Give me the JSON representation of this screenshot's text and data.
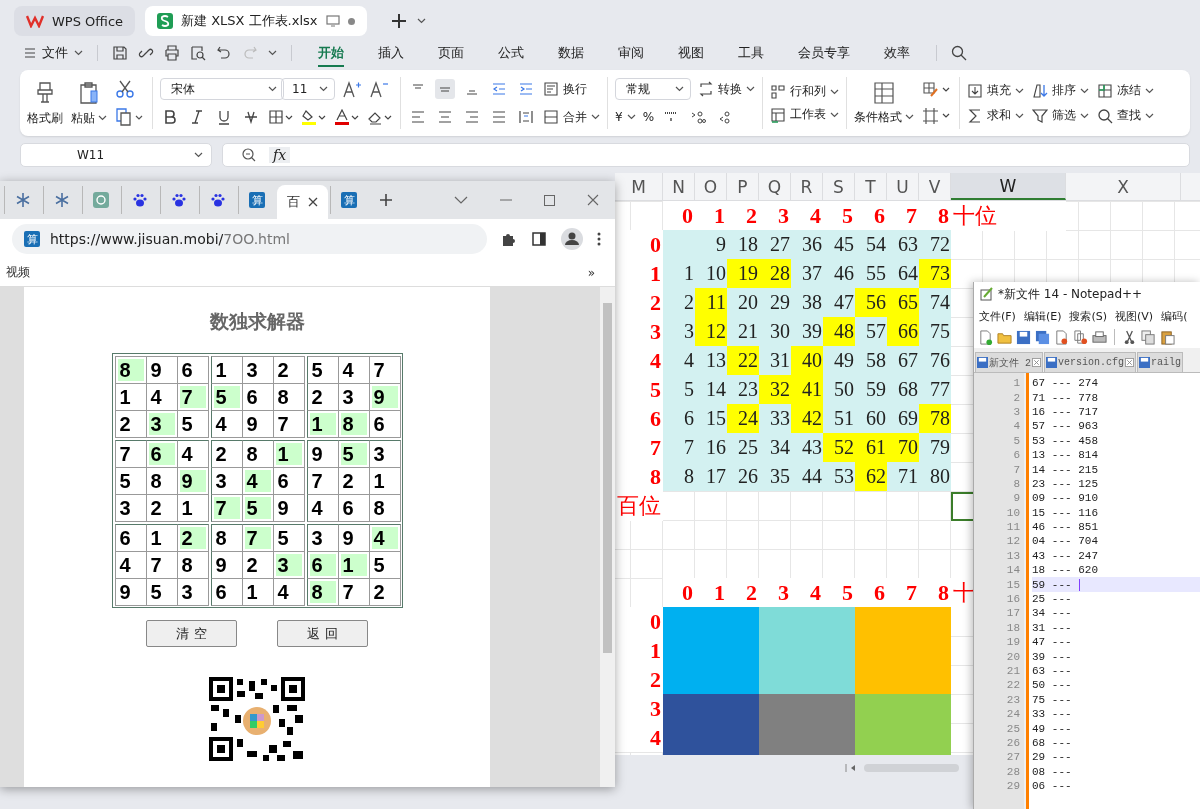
{
  "wps": {
    "tabs": [
      {
        "label": "WPS Office",
        "selected": false
      },
      {
        "label": "新建 XLSX 工作表.xlsx",
        "selected": true
      }
    ],
    "file_menu": "文件",
    "ribbon_tabs": [
      {
        "label": "开始",
        "selected": true
      },
      {
        "label": "插入",
        "selected": false
      },
      {
        "label": "页面",
        "selected": false
      },
      {
        "label": "公式",
        "selected": false
      },
      {
        "label": "数据",
        "selected": false
      },
      {
        "label": "审阅",
        "selected": false
      },
      {
        "label": "视图",
        "selected": false
      },
      {
        "label": "工具",
        "selected": false
      },
      {
        "label": "会员专享",
        "selected": false
      },
      {
        "label": "效率",
        "selected": false
      }
    ],
    "ribbon": {
      "format_painter": "格式刷",
      "paste": "粘贴",
      "font": "宋体",
      "font_size": "11",
      "wrap": "换行",
      "merge": "合并",
      "number_format": "常规",
      "convert": "转换",
      "currency": "¥",
      "percent": "%",
      "rows_cols": "行和列",
      "worksheet": "工作表",
      "conditional_format": "条件格式",
      "fill": "填充",
      "sum": "求和",
      "sort": "排序",
      "filter": "筛选",
      "freeze": "冻结",
      "find": "查找"
    },
    "name_box": "W11",
    "formula_label": "fx"
  },
  "sheet": {
    "columns": [
      {
        "label": "M",
        "selected": false
      },
      {
        "label": "N",
        "selected": false
      },
      {
        "label": "O",
        "selected": false
      },
      {
        "label": "P",
        "selected": false
      },
      {
        "label": "Q",
        "selected": false
      },
      {
        "label": "R",
        "selected": false
      },
      {
        "label": "S",
        "selected": false
      },
      {
        "label": "T",
        "selected": false
      },
      {
        "label": "U",
        "selected": false
      },
      {
        "label": "V",
        "selected": false
      },
      {
        "label": "W",
        "selected": true
      },
      {
        "label": "X",
        "selected": false
      }
    ],
    "grid": {
      "column_digits": [
        "0",
        "1",
        "2",
        "3",
        "4",
        "5",
        "6",
        "7",
        "8"
      ],
      "corner_label": "十位",
      "rows": [
        {
          "label": "0",
          "cells": [
            {
              "highlighted": false
            },
            {
              "text": "9",
              "highlighted": false
            },
            {
              "text": "18",
              "highlighted": false
            },
            {
              "text": "27",
              "highlighted": false
            },
            {
              "text": "36",
              "highlighted": false
            },
            {
              "text": "45",
              "highlighted": false
            },
            {
              "text": "54",
              "highlighted": false
            },
            {
              "text": "63",
              "highlighted": false
            },
            {
              "text": "72",
              "highlighted": false
            }
          ]
        },
        {
          "label": "1",
          "cells": [
            {
              "text": "1",
              "highlighted": false
            },
            {
              "text": "10",
              "highlighted": false
            },
            {
              "text": "19",
              "highlighted": true
            },
            {
              "text": "28",
              "highlighted": true
            },
            {
              "text": "37",
              "highlighted": false
            },
            {
              "text": "46",
              "highlighted": false
            },
            {
              "text": "55",
              "highlighted": false
            },
            {
              "text": "64",
              "highlighted": false
            },
            {
              "text": "73",
              "highlighted": true
            }
          ]
        },
        {
          "label": "2",
          "cells": [
            {
              "text": "2",
              "highlighted": false
            },
            {
              "text": "11",
              "highlighted": true
            },
            {
              "text": "20",
              "highlighted": false
            },
            {
              "text": "29",
              "highlighted": false
            },
            {
              "text": "38",
              "highlighted": false
            },
            {
              "text": "47",
              "highlighted": false
            },
            {
              "text": "56",
              "highlighted": true
            },
            {
              "text": "65",
              "highlighted": true
            },
            {
              "text": "74",
              "highlighted": false
            }
          ]
        },
        {
          "label": "3",
          "cells": [
            {
              "text": "3",
              "highlighted": false
            },
            {
              "text": "12",
              "highlighted": true
            },
            {
              "text": "21",
              "highlighted": false
            },
            {
              "text": "30",
              "highlighted": false
            },
            {
              "text": "39",
              "highlighted": false
            },
            {
              "text": "48",
              "highlighted": true
            },
            {
              "text": "57",
              "highlighted": false
            },
            {
              "text": "66",
              "highlighted": true
            },
            {
              "text": "75",
              "highlighted": false
            }
          ]
        },
        {
          "label": "4",
          "cells": [
            {
              "text": "4",
              "highlighted": false
            },
            {
              "text": "13",
              "highlighted": false
            },
            {
              "text": "22",
              "highlighted": true
            },
            {
              "text": "31",
              "highlighted": false
            },
            {
              "text": "40",
              "highlighted": true
            },
            {
              "text": "49",
              "highlighted": false
            },
            {
              "text": "58",
              "highlighted": false
            },
            {
              "text": "67",
              "highlighted": false
            },
            {
              "text": "76",
              "highlighted": false
            }
          ]
        },
        {
          "label": "5",
          "cells": [
            {
              "text": "5",
              "highlighted": false
            },
            {
              "text": "14",
              "highlighted": false
            },
            {
              "text": "23",
              "highlighted": false
            },
            {
              "text": "32",
              "highlighted": true
            },
            {
              "text": "41",
              "highlighted": true
            },
            {
              "text": "50",
              "highlighted": false
            },
            {
              "text": "59",
              "highlighted": false
            },
            {
              "text": "68",
              "highlighted": false
            },
            {
              "text": "77",
              "highlighted": false
            }
          ]
        },
        {
          "label": "6",
          "cells": [
            {
              "text": "6",
              "highlighted": false
            },
            {
              "text": "15",
              "highlighted": false
            },
            {
              "text": "24",
              "highlighted": true
            },
            {
              "text": "33",
              "highlighted": false
            },
            {
              "text": "42",
              "highlighted": true
            },
            {
              "text": "51",
              "highlighted": false
            },
            {
              "text": "60",
              "highlighted": false
            },
            {
              "text": "69",
              "highlighted": false
            },
            {
              "text": "78",
              "highlighted": true
            }
          ]
        },
        {
          "label": "7",
          "cells": [
            {
              "text": "7",
              "highlighted": false
            },
            {
              "text": "16",
              "highlighted": false
            },
            {
              "text": "25",
              "highlighted": false
            },
            {
              "text": "34",
              "highlighted": false
            },
            {
              "text": "43",
              "highlighted": false
            },
            {
              "text": "52",
              "highlighted": true
            },
            {
              "text": "61",
              "highlighted": true
            },
            {
              "text": "70",
              "highlighted": true
            },
            {
              "text": "79",
              "highlighted": false
            }
          ]
        },
        {
          "label": "8",
          "cells": [
            {
              "text": "8",
              "highlighted": false
            },
            {
              "text": "17",
              "highlighted": false
            },
            {
              "text": "26",
              "highlighted": false
            },
            {
              "text": "35",
              "highlighted": false
            },
            {
              "text": "44",
              "highlighted": false
            },
            {
              "text": "53",
              "highlighted": false
            },
            {
              "text": "62",
              "highlighted": true
            },
            {
              "text": "71",
              "highlighted": false
            },
            {
              "text": "80",
              "highlighted": false
            }
          ]
        }
      ],
      "axis_row": {
        "label": "百位",
        "w_cell_selected": true
      }
    },
    "color_grid": {
      "column_digits": [
        "0",
        "1",
        "2",
        "3",
        "4",
        "5",
        "6",
        "7",
        "8"
      ],
      "corner_label": "十",
      "row_labels": [
        "0",
        "1",
        "2",
        "3",
        "4"
      ],
      "blocks": [
        {
          "color": "#00b0f0"
        },
        {
          "color": "#7fdcd8"
        },
        {
          "color": "#ffc000"
        },
        {
          "color": "#2f529c"
        },
        {
          "color": "#808080"
        },
        {
          "color": "#92d050"
        }
      ]
    }
  },
  "browser": {
    "tabs": [
      {
        "kind": "snowflake",
        "selected": false
      },
      {
        "kind": "snowflake",
        "selected": false
      },
      {
        "kind": "openai",
        "selected": false
      },
      {
        "kind": "paw",
        "selected": false
      },
      {
        "kind": "paw",
        "selected": false
      },
      {
        "kind": "paw",
        "selected": false
      },
      {
        "kind": "calc",
        "favicon_text": "算",
        "selected": false
      },
      {
        "kind": "text",
        "label": "百",
        "selected": true
      },
      {
        "kind": "calc",
        "favicon_text": "算",
        "selected": false
      }
    ],
    "url_favicon_text": "算",
    "url_host": "https://www.jisuan.mobi/",
    "url_path": "7OO.html",
    "bookmarks": [
      "视频"
    ],
    "bookmarks_overflow": "»",
    "page": {
      "title": "数独求解器",
      "sudoku": [
        [
          {
            "digit": "8",
            "highlighted": true
          },
          {
            "digit": "9",
            "highlighted": false
          },
          {
            "digit": "6",
            "highlighted": false
          },
          {
            "digit": "1",
            "highlighted": false
          },
          {
            "digit": "3",
            "highlighted": false
          },
          {
            "digit": "2",
            "highlighted": false
          },
          {
            "digit": "5",
            "highlighted": false
          },
          {
            "digit": "4",
            "highlighted": false
          },
          {
            "digit": "7",
            "highlighted": false
          }
        ],
        [
          {
            "digit": "1",
            "highlighted": false
          },
          {
            "digit": "4",
            "highlighted": false
          },
          {
            "digit": "7",
            "highlighted": true
          },
          {
            "digit": "5",
            "highlighted": true
          },
          {
            "digit": "6",
            "highlighted": false
          },
          {
            "digit": "8",
            "highlighted": false
          },
          {
            "digit": "2",
            "highlighted": false
          },
          {
            "digit": "3",
            "highlighted": false
          },
          {
            "digit": "9",
            "highlighted": true
          }
        ],
        [
          {
            "digit": "2",
            "highlighted": false
          },
          {
            "digit": "3",
            "highlighted": true
          },
          {
            "digit": "5",
            "highlighted": false
          },
          {
            "digit": "4",
            "highlighted": false
          },
          {
            "digit": "9",
            "highlighted": false
          },
          {
            "digit": "7",
            "highlighted": false
          },
          {
            "digit": "1",
            "highlighted": true
          },
          {
            "digit": "8",
            "highlighted": true
          },
          {
            "digit": "6",
            "highlighted": false
          }
        ],
        [
          {
            "digit": "7",
            "highlighted": false
          },
          {
            "digit": "6",
            "highlighted": true
          },
          {
            "digit": "4",
            "highlighted": false
          },
          {
            "digit": "2",
            "highlighted": false
          },
          {
            "digit": "8",
            "highlighted": false
          },
          {
            "digit": "1",
            "highlighted": true
          },
          {
            "digit": "9",
            "highlighted": false
          },
          {
            "digit": "5",
            "highlighted": true
          },
          {
            "digit": "3",
            "highlighted": false
          }
        ],
        [
          {
            "digit": "5",
            "highlighted": false
          },
          {
            "digit": "8",
            "highlighted": false
          },
          {
            "digit": "9",
            "highlighted": true
          },
          {
            "digit": "3",
            "highlighted": false
          },
          {
            "digit": "4",
            "highlighted": true
          },
          {
            "digit": "6",
            "highlighted": false
          },
          {
            "digit": "7",
            "highlighted": false
          },
          {
            "digit": "2",
            "highlighted": false
          },
          {
            "digit": "1",
            "highlighted": false
          }
        ],
        [
          {
            "digit": "3",
            "highlighted": false
          },
          {
            "digit": "2",
            "highlighted": false
          },
          {
            "digit": "1",
            "highlighted": false
          },
          {
            "digit": "7",
            "highlighted": true
          },
          {
            "digit": "5",
            "highlighted": true
          },
          {
            "digit": "9",
            "highlighted": false
          },
          {
            "digit": "4",
            "highlighted": false
          },
          {
            "digit": "6",
            "highlighted": false
          },
          {
            "digit": "8",
            "highlighted": false
          }
        ],
        [
          {
            "digit": "6",
            "highlighted": false
          },
          {
            "digit": "1",
            "highlighted": false
          },
          {
            "digit": "2",
            "highlighted": true
          },
          {
            "digit": "8",
            "highlighted": false
          },
          {
            "digit": "7",
            "highlighted": true
          },
          {
            "digit": "5",
            "highlighted": false
          },
          {
            "digit": "3",
            "highlighted": false
          },
          {
            "digit": "9",
            "highlighted": false
          },
          {
            "digit": "4",
            "highlighted": true
          }
        ],
        [
          {
            "digit": "4",
            "highlighted": false
          },
          {
            "digit": "7",
            "highlighted": false
          },
          {
            "digit": "8",
            "highlighted": false
          },
          {
            "digit": "9",
            "highlighted": false
          },
          {
            "digit": "2",
            "highlighted": false
          },
          {
            "digit": "3",
            "highlighted": true
          },
          {
            "digit": "6",
            "highlighted": true
          },
          {
            "digit": "1",
            "highlighted": true
          },
          {
            "digit": "5",
            "highlighted": false
          }
        ],
        [
          {
            "digit": "9",
            "highlighted": false
          },
          {
            "digit": "5",
            "highlighted": false
          },
          {
            "digit": "3",
            "highlighted": false
          },
          {
            "digit": "6",
            "highlighted": false
          },
          {
            "digit": "1",
            "highlighted": false
          },
          {
            "digit": "4",
            "highlighted": false
          },
          {
            "digit": "8",
            "highlighted": true
          },
          {
            "digit": "7",
            "highlighted": false
          },
          {
            "digit": "2",
            "highlighted": false
          }
        ]
      ],
      "buttons": [
        "清 空",
        "返 回"
      ]
    }
  },
  "notepad": {
    "title": "*新文件 14 - Notepad++",
    "menu": [
      "文件(F)",
      "编辑(E)",
      "搜索(S)",
      "视图(V)",
      "编码("
    ],
    "tabs": [
      "新文件 2",
      "version.cfg",
      "railg"
    ],
    "lines": [
      {
        "number": "1",
        "text": "67 --- 274",
        "current": false
      },
      {
        "number": "2",
        "text": "71 --- 778",
        "current": false
      },
      {
        "number": "3",
        "text": "16 --- 717",
        "current": false
      },
      {
        "number": "4",
        "text": "57 --- 963",
        "current": false
      },
      {
        "number": "5",
        "text": "53 --- 458",
        "current": false
      },
      {
        "number": "6",
        "text": "13 --- 814",
        "current": false
      },
      {
        "number": "7",
        "text": "14 --- 215",
        "current": false
      },
      {
        "number": "8",
        "text": "23 --- 125",
        "current": false
      },
      {
        "number": "9",
        "text": "09 --- 910",
        "current": false
      },
      {
        "number": "10",
        "text": "15 --- 116",
        "current": false
      },
      {
        "number": "11",
        "text": "46 --- 851",
        "current": false
      },
      {
        "number": "12",
        "text": "04 --- 704",
        "current": false
      },
      {
        "number": "13",
        "text": "43 --- 247",
        "current": false
      },
      {
        "number": "14",
        "text": "18 --- 620",
        "current": false
      },
      {
        "number": "15",
        "text": "59 ---",
        "current": true
      },
      {
        "number": "16",
        "text": "25 ---",
        "current": false
      },
      {
        "number": "17",
        "text": "34 ---",
        "current": false
      },
      {
        "number": "18",
        "text": "31 ---",
        "current": false
      },
      {
        "number": "19",
        "text": "47 ---",
        "current": false
      },
      {
        "number": "20",
        "text": "39 ---",
        "current": false
      },
      {
        "number": "21",
        "text": "63 ---",
        "current": false
      },
      {
        "number": "22",
        "text": "50 ---",
        "current": false
      },
      {
        "number": "23",
        "text": "75 ---",
        "current": false
      },
      {
        "number": "24",
        "text": "33 ---",
        "current": false
      },
      {
        "number": "25",
        "text": "49 ---",
        "current": false
      },
      {
        "number": "26",
        "text": "68 ---",
        "current": false
      },
      {
        "number": "27",
        "text": "29 ---",
        "current": false
      },
      {
        "number": "28",
        "text": "08 ---",
        "current": false
      },
      {
        "number": "29",
        "text": "06 ---",
        "current": false
      }
    ]
  }
}
